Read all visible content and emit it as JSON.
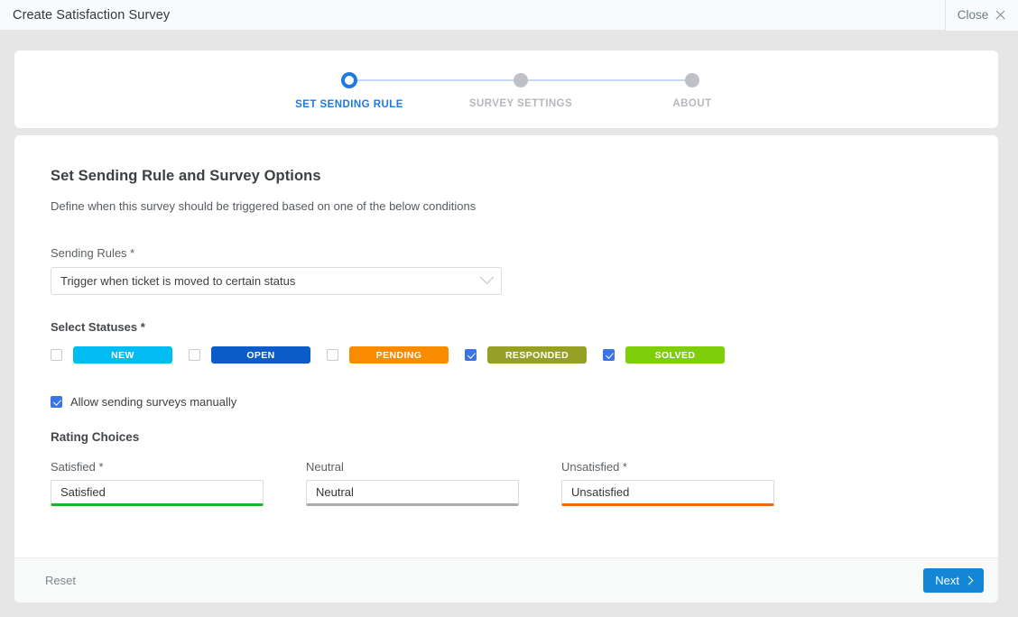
{
  "window": {
    "title": "Create Satisfaction Survey",
    "close_label": "Close",
    "close_icon": "close-icon"
  },
  "stepper": {
    "steps": [
      {
        "label": "SET SENDING RULE",
        "state": "active"
      },
      {
        "label": "SURVEY SETTINGS",
        "state": "inactive"
      },
      {
        "label": "ABOUT",
        "state": "inactive"
      }
    ],
    "active_color": "#1f7ae0",
    "inactive_color": "#bdc1c6",
    "line_color": "#c4d9f2"
  },
  "main": {
    "title": "Set Sending Rule and Survey Options",
    "description": "Define when this survey should be triggered based on one of the below conditions",
    "sending_rules": {
      "label": "Sending Rules *",
      "value": "Trigger when ticket is moved to certain status",
      "chevron_icon": "chevron-down-icon"
    },
    "select_statuses": {
      "label": "Select Statuses *",
      "items": [
        {
          "label": "NEW",
          "color": "#00bcf2",
          "checked": false
        },
        {
          "label": "OPEN",
          "color": "#0b5cc8",
          "checked": false
        },
        {
          "label": "PENDING",
          "color": "#f98b00",
          "checked": false
        },
        {
          "label": "RESPONDED",
          "color": "#96a026",
          "checked": true
        },
        {
          "label": "SOLVED",
          "color": "#7ecf09",
          "checked": true
        }
      ]
    },
    "allow_manual": {
      "label": "Allow sending surveys manually",
      "checked": true
    },
    "rating_choices": {
      "title": "Rating Choices",
      "fields": [
        {
          "label": "Satisfied *",
          "value": "Satisfied",
          "placeholder": "Satisfied",
          "underline_color": "#16b723"
        },
        {
          "label": "Neutral",
          "value": "Neutral",
          "placeholder": "Neutral",
          "underline_color": "#a9acae"
        },
        {
          "label": "Unsatisfied *",
          "value": "Unsatisfied",
          "placeholder": "Unsatisfied",
          "underline_color": "#ec6a0a"
        }
      ]
    }
  },
  "footer": {
    "reset_label": "Reset",
    "next_label": "Next",
    "next_icon": "chevron-right-icon",
    "next_color": "#1386d6"
  }
}
